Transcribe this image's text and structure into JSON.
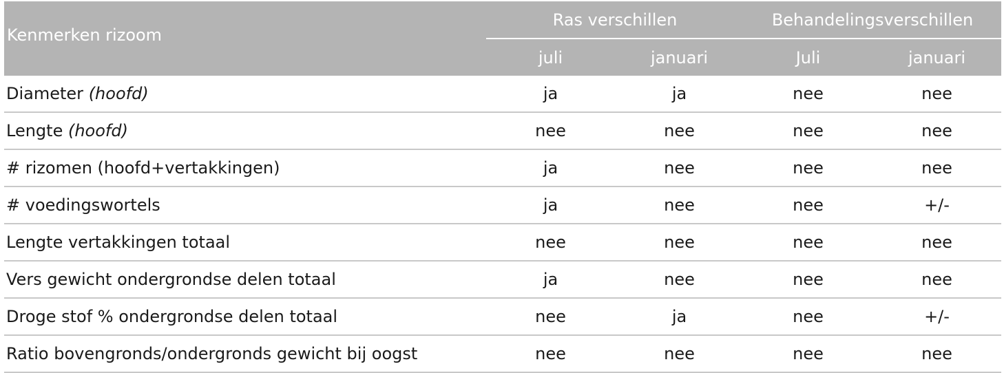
{
  "table": {
    "row_header": "Kenmerken rizoom",
    "groups": [
      {
        "label": "Ras verschillen",
        "columns": [
          "juli",
          "januari"
        ]
      },
      {
        "label": "Behandelingsverschillen",
        "columns": [
          "Juli",
          "januari"
        ]
      }
    ],
    "rows": [
      {
        "label": "Diameter",
        "qualifier": "(hoofd)",
        "values": [
          "ja",
          "ja",
          "nee",
          "nee"
        ]
      },
      {
        "label": "Lengte",
        "qualifier": "(hoofd)",
        "values": [
          "nee",
          "nee",
          "nee",
          "nee"
        ]
      },
      {
        "label": "# rizomen (hoofd+vertakkingen)",
        "qualifier": "",
        "values": [
          "ja",
          "nee",
          "nee",
          "nee"
        ]
      },
      {
        "label": "# voedingswortels",
        "qualifier": "",
        "values": [
          "ja",
          "nee",
          "nee",
          "+/-"
        ]
      },
      {
        "label": "Lengte vertakkingen totaal",
        "qualifier": "",
        "values": [
          "nee",
          "nee",
          "nee",
          "nee"
        ]
      },
      {
        "label": "Vers gewicht ondergrondse delen totaal",
        "qualifier": "",
        "values": [
          "ja",
          "nee",
          "nee",
          "nee"
        ]
      },
      {
        "label": "Droge stof % ondergrondse delen totaal",
        "qualifier": "",
        "values": [
          "nee",
          "ja",
          "nee",
          "+/-"
        ]
      },
      {
        "label": "Ratio bovengronds/ondergronds gewicht bij oogst",
        "qualifier": "",
        "values": [
          "nee",
          "nee",
          "nee",
          "nee"
        ]
      }
    ]
  },
  "colors": {
    "header_bg": "#b4b4b4",
    "header_text": "#ffffff",
    "row_divider": "#c8c8c8",
    "body_text": "#1a1a1a"
  }
}
